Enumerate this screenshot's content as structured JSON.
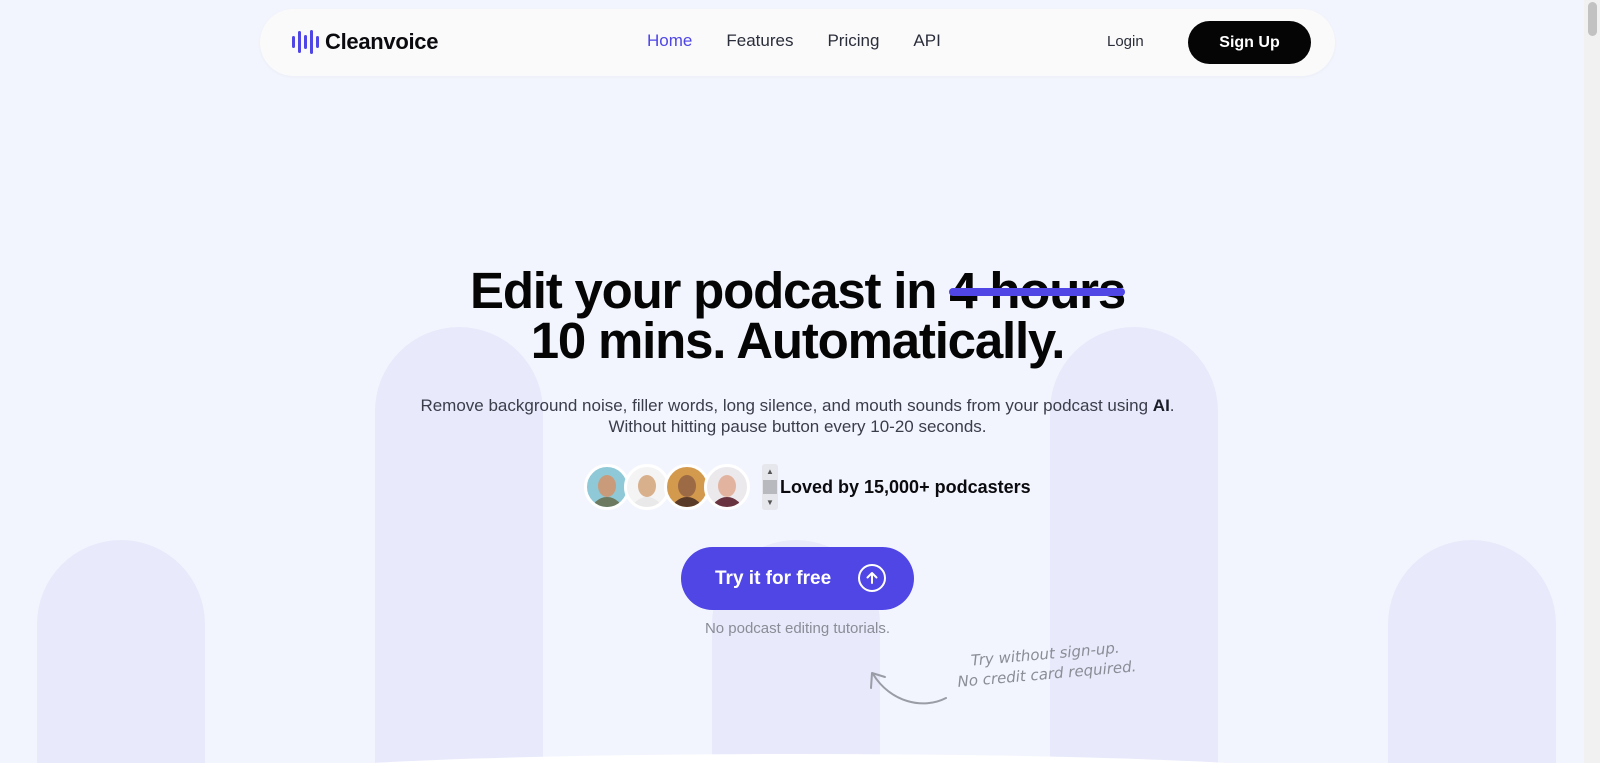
{
  "nav": {
    "logo_text": "Cleanvoice",
    "links": [
      "Home",
      "Features",
      "Pricing",
      "API"
    ],
    "login": "Login",
    "signup": "Sign Up"
  },
  "hero": {
    "title_prefix": "Edit your podcast in ",
    "title_struck": "4 hours",
    "title_line2": "10 mins. Automatically.",
    "subtitle_before": "Remove background noise, filler words, long silence, and mouth sounds from your podcast using ",
    "subtitle_bold": "AI",
    "subtitle_after": ".",
    "subtitle_line2": "Without hitting pause button every 10-20 seconds.",
    "social_proof": "Loved by 15,000+ podcasters",
    "cta": "Try it for free",
    "cta_note": "No podcast editing tutorials.",
    "hand_note_line1": "Try without sign-up.",
    "hand_note_line2": "No credit card required."
  },
  "colors": {
    "accent": "#4f46e5",
    "background": "#f3f5fe",
    "button_dark": "#050505"
  },
  "icons": [
    "logo-waveform-icon",
    "arrow-up-circle-icon",
    "curved-arrow-icon"
  ]
}
